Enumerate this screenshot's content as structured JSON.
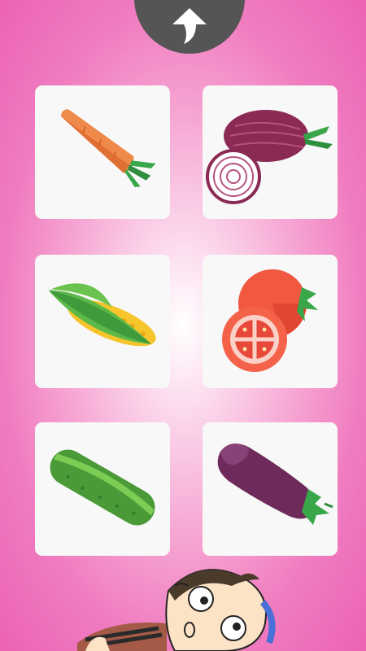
{
  "back_button": {
    "icon": "up-arrow-icon"
  },
  "grid": {
    "items": [
      {
        "name": "carrot",
        "icon": "carrot-icon"
      },
      {
        "name": "onion",
        "icon": "onion-icon"
      },
      {
        "name": "corn",
        "icon": "corn-icon"
      },
      {
        "name": "tomato",
        "icon": "tomato-icon"
      },
      {
        "name": "cucumber",
        "icon": "cucumber-icon"
      },
      {
        "name": "eggplant",
        "icon": "eggplant-icon"
      }
    ]
  },
  "colors": {
    "background": "#ec63b4",
    "card": "#f8f8f8",
    "button": "#555555"
  }
}
